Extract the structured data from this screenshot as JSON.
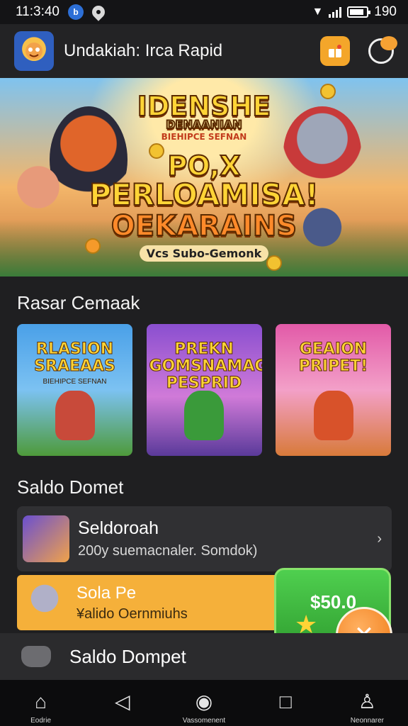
{
  "status_bar": {
    "time": "11:3:40",
    "badge": "b",
    "battery": "190"
  },
  "header": {
    "title": "Undakiah: Irca Rapid"
  },
  "hero": {
    "line1": "IDENSHE",
    "line2": "DENAANIAN",
    "line3": "BIEHIPCE SEFNAN",
    "line4": "PO,X",
    "line5": "PERLOAMISA!",
    "line6": "OEKARAINS",
    "tagline": "Vcs Subo-Gemonk"
  },
  "section_games": {
    "title": "Rasar Cemaak"
  },
  "game_cards": [
    {
      "title": "RLASION SRAEAAS",
      "subtitle": "BIEHIPCE SEFNAN",
      "bg": "#4aa0e8"
    },
    {
      "title": "PREKN GOMSNAMAG PESPRID",
      "subtitle": "",
      "bg": "#8a4fd0"
    },
    {
      "title": "GEAION PRIPET!",
      "subtitle": "",
      "bg": "#e25aa8"
    }
  ],
  "section_wallet": {
    "title": "Saldo Domet"
  },
  "wallet_item": {
    "title": "Seldoroah",
    "subtitle": "200y suemacnaler. Somdok)"
  },
  "promo": {
    "title": "Sola Pe",
    "subtitle": "¥alido Oernmiuhs"
  },
  "wallet_button": {
    "amount": "$50.0"
  },
  "dock": {
    "label": "Saldo Dompet"
  },
  "nav": {
    "home_label": "Eodrie",
    "center_label": "Vassomenent",
    "profile_label": "Neonnarer"
  }
}
